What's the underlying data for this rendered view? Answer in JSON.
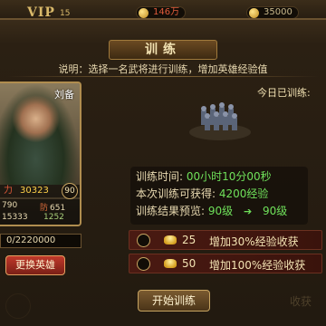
{
  "header": {
    "vip_label": "VIP",
    "vip_level": "15",
    "stat_red": "146万",
    "stat_gold": "35000"
  },
  "panel": {
    "title": "训练",
    "description": "说明：选择一名武将进行训练，增加英雄经验值"
  },
  "hero": {
    "name": "刘备",
    "power_label": "力",
    "power": "30323",
    "level": "90",
    "stat_a": "790",
    "stat_b_tag": "防",
    "stat_b": "651",
    "stat_c": "15333",
    "stat_d": "1252",
    "exp": "0/2220000",
    "change_button": "更换英雄"
  },
  "training": {
    "today_label": "今日已训练:",
    "time_label": "训练时间:",
    "time_value": "00小时10分00秒",
    "gain_label": "本次训练可获得:",
    "gain_value": "4200经验",
    "preview_label": "训练结果预览:",
    "level_from": "90级",
    "level_to": "90级"
  },
  "options": [
    {
      "cost": "25",
      "text": "增加30%经验收获"
    },
    {
      "cost": "50",
      "text": "增加100%经验收获"
    }
  ],
  "start_button": "开始训练",
  "corner_text": "收获",
  "colors": {
    "accent_green": "#6fe05a",
    "gold": "#c7a461",
    "red_button": "#c0392b"
  }
}
